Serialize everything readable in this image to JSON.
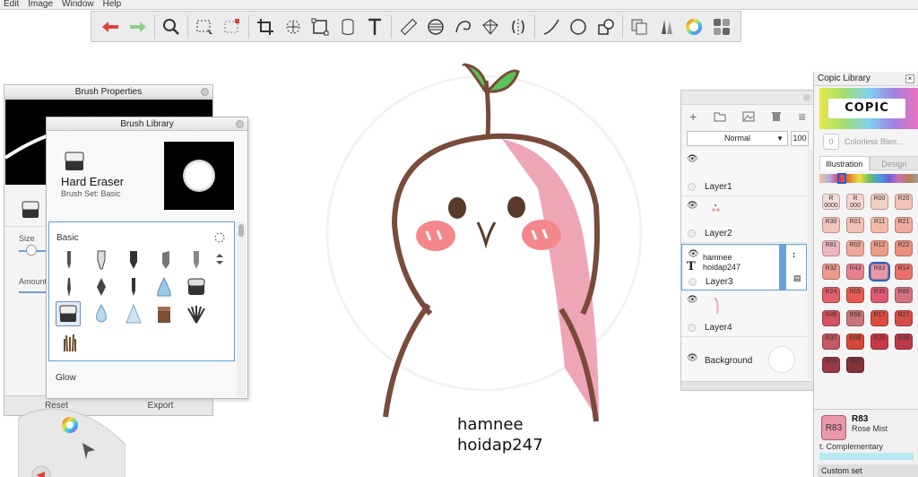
{
  "menu": [
    "Edit",
    "Image",
    "Window",
    "Help"
  ],
  "toolbar": {
    "buttons": [
      "undo",
      "redo",
      "zoom",
      "selection",
      "crop-selection",
      "crop",
      "lasso",
      "distort",
      "cylinder",
      "text",
      "ruler",
      "ellipse-guide",
      "french-curve",
      "perspective",
      "symmetry",
      "stroke",
      "circle",
      "shape",
      "copy",
      "brush-library",
      "color-wheel",
      "palette"
    ]
  },
  "canvas": {
    "signature_line1": "hamnee",
    "signature_line2": "hoidap247"
  },
  "brush_properties": {
    "title": "Brush Properties",
    "size_label": "Size",
    "amount_label": "Amount",
    "reset_label": "Reset",
    "export_label": "Export"
  },
  "brush_library": {
    "title": "Brush Library",
    "brush_name": "Hard Eraser",
    "brush_set": "Brush Set: Basic",
    "section_basic": "Basic",
    "section_glow": "Glow"
  },
  "layers": {
    "blend_mode": "Normal",
    "opacity": "100",
    "items": [
      {
        "name": "Layer1",
        "text": ""
      },
      {
        "name": "Layer2",
        "text": ""
      },
      {
        "name": "Layer3",
        "text_line1": "hamnee",
        "text_line2": "hoidap247"
      },
      {
        "name": "Layer4",
        "text": ""
      },
      {
        "name": "Background",
        "text": ""
      }
    ]
  },
  "copic": {
    "title": "Copic Library",
    "logo": "COPIC",
    "colorless_chip": "0",
    "colorless_label": "Colorless Blen...",
    "tab_illustration": "Illustration",
    "tab_design": "Design",
    "swatches": [
      {
        "code": "R\n0000",
        "color": "#f6ded8"
      },
      {
        "code": "R\n000",
        "color": "#f4d4cc"
      },
      {
        "code": "R00",
        "color": "#f2cfc4"
      },
      {
        "code": "R20",
        "color": "#f4c2b6"
      },
      {
        "code": "R30",
        "color": "#f2c4bc"
      },
      {
        "code": "R01",
        "color": "#f1c0b6"
      },
      {
        "code": "R11",
        "color": "#f2bba8"
      },
      {
        "code": "R21",
        "color": "#f0aa9c"
      },
      {
        "code": "R81",
        "color": "#eeb6c0"
      },
      {
        "code": "R02",
        "color": "#eea998"
      },
      {
        "code": "R12",
        "color": "#ee9e88"
      },
      {
        "code": "R22",
        "color": "#ec9080"
      },
      {
        "code": "R32",
        "color": "#ec9a90"
      },
      {
        "code": "R43",
        "color": "#e88090"
      },
      {
        "code": "R83",
        "color": "#e898a8"
      },
      {
        "code": "R14",
        "color": "#e8706a"
      },
      {
        "code": "R24",
        "color": "#e2606a"
      },
      {
        "code": "R05",
        "color": "#e65a52"
      },
      {
        "code": "R35",
        "color": "#de5a70"
      },
      {
        "code": "R85",
        "color": "#d67080"
      },
      {
        "code": "R46",
        "color": "#d2525e"
      },
      {
        "code": "R56",
        "color": "#c87478"
      },
      {
        "code": "R17",
        "color": "#dc4c40"
      },
      {
        "code": "R27",
        "color": "#d64c48"
      },
      {
        "code": "R37",
        "color": "#c25a62"
      },
      {
        "code": "R08",
        "color": "#d44838"
      },
      {
        "code": "R29",
        "color": "#c83844"
      },
      {
        "code": "R39",
        "color": "#b83a48"
      },
      {
        "code": "R59",
        "color": "#9a3a44"
      },
      {
        "code": "R89",
        "color": "#843238"
      }
    ],
    "selected_code": "R83",
    "selected_name": "Rose Mist",
    "complementary_label": "t. Complementary",
    "custom_set_label": "Custom set"
  }
}
